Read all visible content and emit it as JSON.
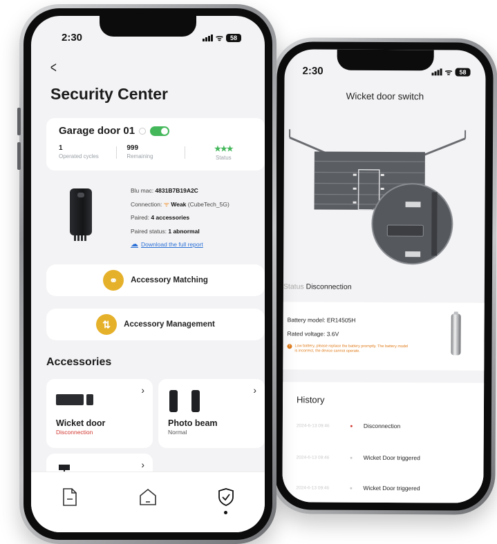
{
  "front": {
    "status_time": "2:30",
    "battery_level": "58",
    "back_glyph": "<",
    "page_title": "Security Center",
    "device": {
      "name": "Garage door 01",
      "enabled": true,
      "stats": [
        {
          "value": "1",
          "label": "Operated cycles"
        },
        {
          "value": "999",
          "label": "Remaining"
        },
        {
          "value": "★★★",
          "label": "Status"
        }
      ],
      "blu_mac_label": "Blu mac:",
      "blu_mac_value": "4831B7B19A2C",
      "connection_label": "Connection:",
      "connection_value": "Weak",
      "connection_network": "(CubeTech_5G)",
      "paired_label": "Paired:",
      "paired_value": "4 accessories",
      "paired_status_label": "Paired status:",
      "paired_status_value": "1 abnormal",
      "report_link": "Download the full report"
    },
    "actions": {
      "matching": "Accessory Matching",
      "management": "Accessory Management"
    },
    "accessories_title": "Accessories",
    "accessories": [
      {
        "name": "Wicket door",
        "status": "Disconnection"
      },
      {
        "name": "Photo beam",
        "status": "Normal"
      },
      {
        "name": "",
        "status": ""
      }
    ],
    "nav": [
      "document-icon",
      "home-icon",
      "shield-check-icon"
    ],
    "chevron": "›"
  },
  "back": {
    "status_time": "2:30",
    "battery_level": "58",
    "title": "Wicket door switch",
    "status_label": "Status",
    "status_value": "Disconnection",
    "battery_model_label": "Battery model:",
    "battery_model_value": "ER14505H",
    "rated_voltage_label": "Rated voltage:",
    "rated_voltage_value": "3.6V",
    "warning": "Low battery, please replace the battery promptly. The battery model is incorrect, the device cannot operate.",
    "history_title": "History",
    "history": [
      {
        "time": "2024-6-13 09:46",
        "event": "Disconnection",
        "highlight": true
      },
      {
        "time": "2024-6-13 09:46",
        "event": "Wicket Door triggered",
        "highlight": false
      },
      {
        "time": "2024-6-13 09:46",
        "event": "Wicket Door triggered",
        "highlight": false
      }
    ]
  },
  "colors": {
    "accent_green": "#43b75a",
    "accent_gold": "#e6b12a",
    "alert_red": "#d23a32",
    "warning_orange": "#e07b1a",
    "link_blue": "#2a6fd6"
  }
}
